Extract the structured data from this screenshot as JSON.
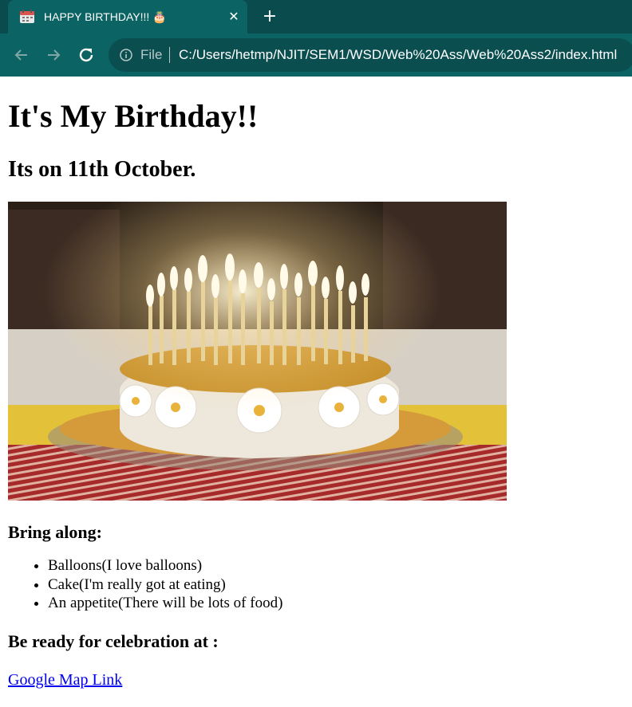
{
  "browser": {
    "tab_title": "HAPPY BIRTHDAY!!! 🎂",
    "tab_favicon": "calendar-icon",
    "close_label": "✕",
    "new_tab_label": "+",
    "omnibox": {
      "scheme": "File",
      "url": "C:/Users/hetmp/NJIT/SEM1/WSD/Web%20Ass/Web%20Ass2/index.html"
    },
    "icons": [
      "back-arrow-icon",
      "forward-arrow-icon",
      "reload-icon",
      "info-icon"
    ]
  },
  "page": {
    "heading": "It's My Birthday!!",
    "subheading": "Its on 11th October.",
    "bring_heading": "Bring along:",
    "bring_items": [
      "Balloons(I love balloons)",
      "Cake(I'm really got at eating)",
      "An appetite(There will be lots of food)"
    ],
    "celebration_heading": "Be ready for celebration at :",
    "map_link": "Google Map Link"
  },
  "colors": {
    "chrome_bg": "#0b6363",
    "tabstrip_bg": "#0a4b4d",
    "link": "#0000ee"
  }
}
